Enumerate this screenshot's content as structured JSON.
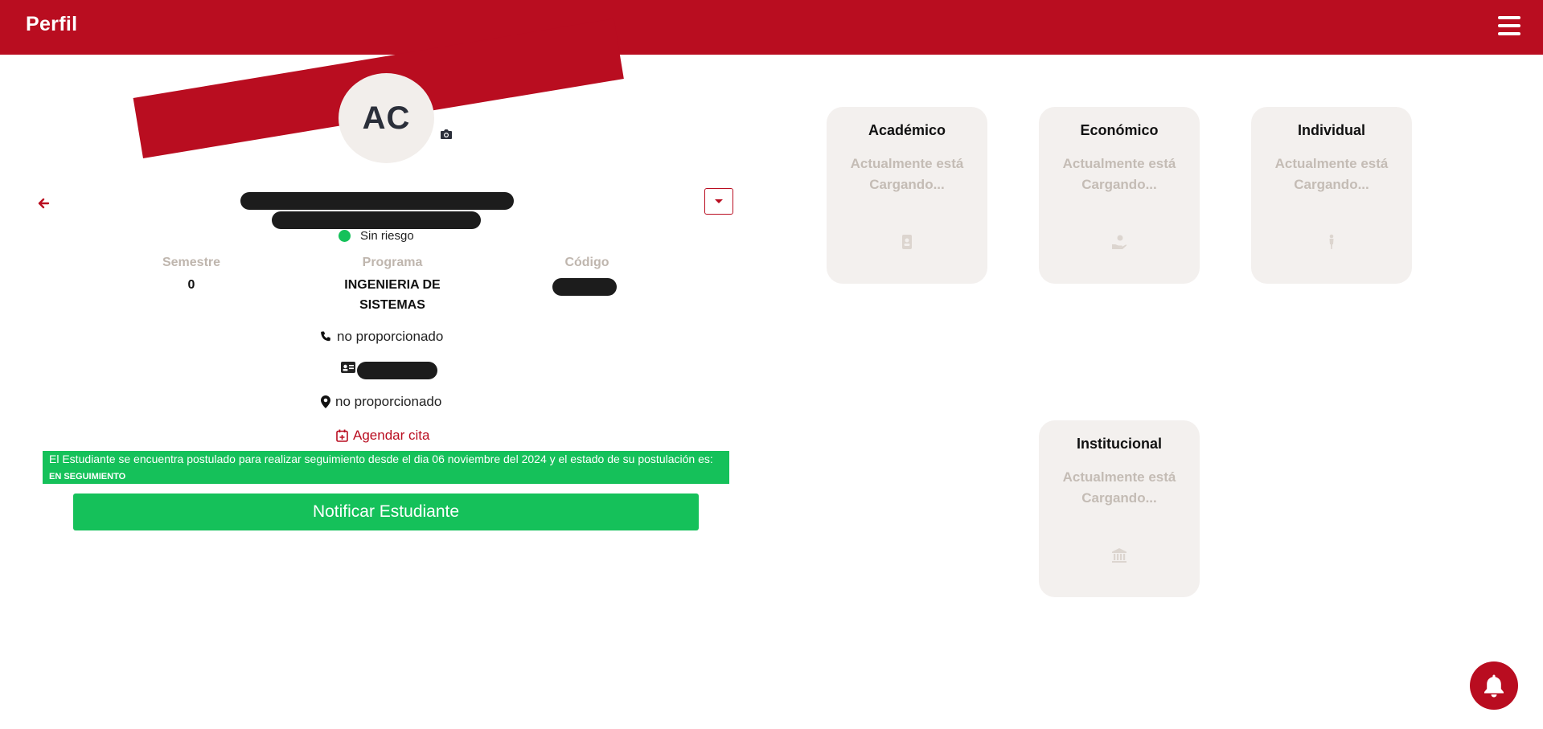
{
  "header": {
    "title": "Perfil",
    "menu_icon": "hamburger-menu-icon"
  },
  "profile": {
    "initials": "AC",
    "risk_label": "Sin riesgo",
    "info": {
      "semester_label": "Semestre",
      "semester_value": "0",
      "program_label": "Programa",
      "program_value": "INGENIERIA DE SISTEMAS",
      "code_label": "Código"
    },
    "phone": "no proporcionado",
    "address": "no proporcionado",
    "schedule_link": "Agendar cita"
  },
  "notice": {
    "text": "El Estudiante se encuentra postulado para realizar seguimiento desde el dia 06 noviembre del 2024 y el estado de su postulación es: ",
    "status": "EN SEGUIMIENTO"
  },
  "notify_button": "Notificar Estudiante",
  "cards": [
    {
      "title": "Académico",
      "status": "Actualmente está Cargando...",
      "icon": "id-badge-icon"
    },
    {
      "title": "Económico",
      "status": "Actualmente está Cargando...",
      "icon": "hand-money-icon"
    },
    {
      "title": "Individual",
      "status": "Actualmente está Cargando...",
      "icon": "person-icon"
    },
    {
      "title": "Institucional",
      "status": "Actualmente está Cargando...",
      "icon": "building-columns-icon"
    }
  ],
  "colors": {
    "primary": "#b90d20",
    "success": "#15c15a",
    "card_bg": "#f3f0ee",
    "muted_text": "#c4bcb5"
  }
}
